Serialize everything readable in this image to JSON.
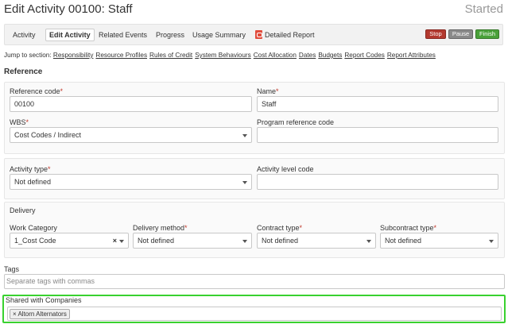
{
  "header": {
    "title": "Edit Activity 00100: Staff",
    "status": "Started"
  },
  "tabs": [
    {
      "label": "Activity"
    },
    {
      "label": "Edit Activity"
    },
    {
      "label": "Related Events"
    },
    {
      "label": "Progress"
    },
    {
      "label": "Usage Summary"
    },
    {
      "label": "Detailed Report",
      "icon": "pdf-icon"
    }
  ],
  "actions": {
    "stop": "Stop",
    "pause": "Pause",
    "finish": "Finish",
    "colors": {
      "stop": "#b3392f",
      "pause": "#8a8a8a",
      "finish": "#4aa13a"
    }
  },
  "jump": {
    "label": "Jump to section:",
    "links": [
      "Responsibility",
      "Resource Profiles",
      "Rules of Credit",
      "System Behaviours",
      "Cost Allocation",
      "Dates",
      "Budgets",
      "Report Codes",
      "Report Attributes"
    ]
  },
  "reference": {
    "heading": "Reference",
    "reference_code": {
      "label": "Reference code",
      "value": "00100"
    },
    "name": {
      "label": "Name",
      "value": "Staff"
    },
    "wbs": {
      "label": "WBS",
      "value": "Cost Codes / Indirect"
    },
    "program_reference_code": {
      "label": "Program reference code",
      "value": ""
    }
  },
  "activity": {
    "activity_type": {
      "label": "Activity type",
      "value": "Not defined"
    },
    "activity_level_code": {
      "label": "Activity level code",
      "value": ""
    }
  },
  "delivery": {
    "heading": "Delivery",
    "work_category": {
      "label": "Work Category",
      "value": "1_Cost Code",
      "clear": "×"
    },
    "delivery_method": {
      "label": "Delivery method",
      "value": "Not defined"
    },
    "contract_type": {
      "label": "Contract type",
      "value": "Not defined"
    },
    "subcontract_type": {
      "label": "Subcontract type",
      "value": "Not defined"
    }
  },
  "tags": {
    "label": "Tags",
    "placeholder": "Separate tags with commas"
  },
  "shared": {
    "label": "Shared with Companies",
    "chips": [
      {
        "remove": "×",
        "label": "Altorn Alternators"
      }
    ],
    "highlight_color": "#39d12f"
  },
  "required_marker": "*"
}
